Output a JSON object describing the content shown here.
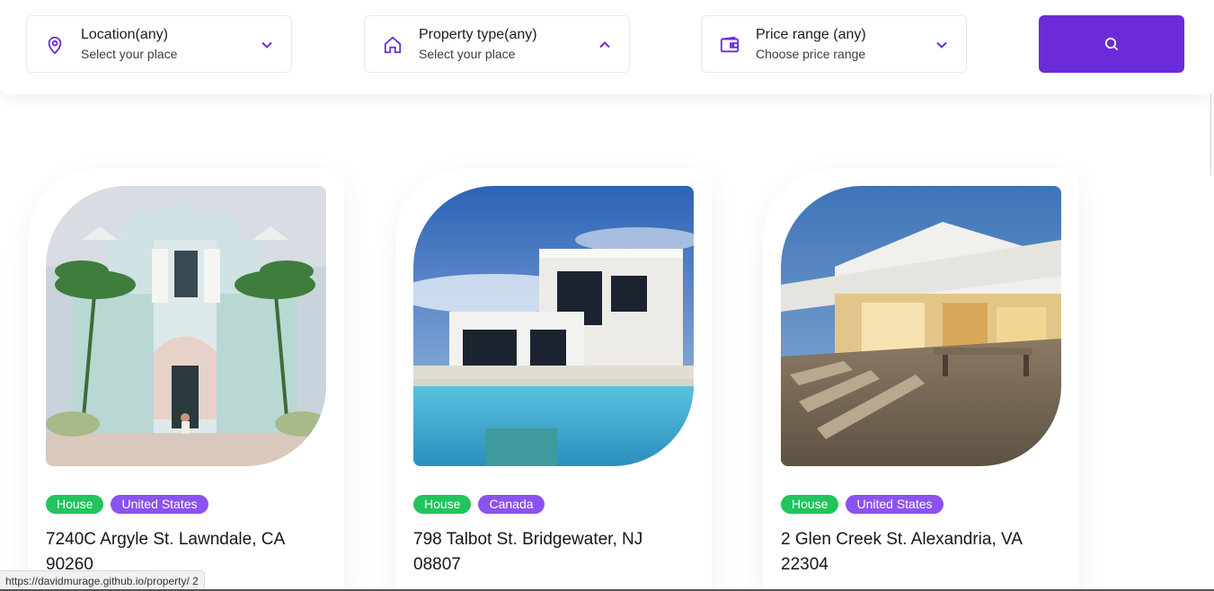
{
  "filters": {
    "location": {
      "title": "Location(any)",
      "subtitle": "Select your place",
      "icon": "map-pin-icon",
      "chevron": "chevron-down-icon"
    },
    "property_type": {
      "title": "Property type(any)",
      "subtitle": "Select your place",
      "icon": "home-icon",
      "chevron": "chevron-up-icon"
    },
    "price_range": {
      "title": "Price range (any)",
      "subtitle": "Choose price range",
      "icon": "wallet-icon",
      "chevron": "chevron-down-icon"
    },
    "search_icon": "search-icon"
  },
  "listings": [
    {
      "type": "House",
      "country": "United States",
      "address": "7240C Argyle St. Lawndale, CA 90260"
    },
    {
      "type": "House",
      "country": "Canada",
      "address": "798 Talbot St. Bridgewater, NJ 08807"
    },
    {
      "type": "House",
      "country": "United States",
      "address": "2 Glen Creek St. Alexandria, VA 22304"
    }
  ],
  "status_bar": {
    "url": "https://davidmurage.github.io/property/ 2"
  },
  "colors": {
    "accent": "#6c2bd9",
    "tag_type": "#21c45d",
    "tag_country": "#8b52f0"
  }
}
